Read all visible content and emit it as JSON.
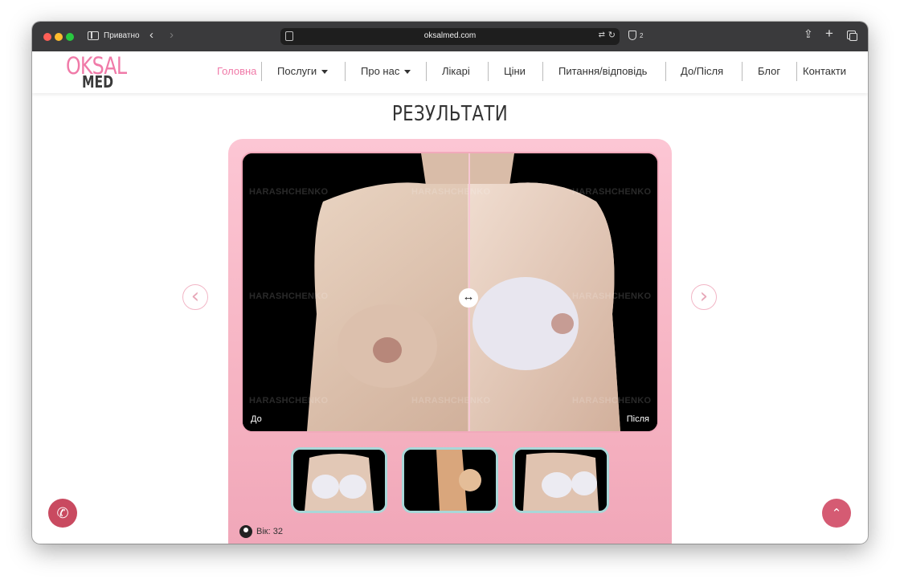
{
  "browser": {
    "private_label": "Приватно",
    "url": "oksalmed.com",
    "back_glyph": "‹",
    "forward_glyph": "›",
    "blocked_count": "2",
    "icons": [
      "sidebar-toggle-icon",
      "back-icon",
      "forward-icon",
      "page-icon",
      "translate-icon",
      "reload-icon",
      "shield-icon",
      "share-icon",
      "new-tab-icon",
      "tabs-overview-icon"
    ]
  },
  "site": {
    "logo": {
      "top": "OKSAL",
      "bottom": "MED"
    },
    "nav": [
      {
        "label": "Головна",
        "active": true
      },
      {
        "label": "Послуги",
        "dropdown": true
      },
      {
        "label": "Про нас",
        "dropdown": true
      },
      {
        "label": "Лікарі"
      },
      {
        "label": "Ціни"
      },
      {
        "label": "Питання/відповідь"
      },
      {
        "label": "До/Після"
      },
      {
        "label": "Блог"
      },
      {
        "label": "Контакти"
      }
    ]
  },
  "section": {
    "title": "РЕЗУЛЬТАТИ",
    "compare": {
      "before_label": "До",
      "after_label": "Після",
      "handle_glyph": "↔",
      "watermark": "HARASHCHENKO"
    },
    "prev_glyph": "‹",
    "next_glyph": "›",
    "thumbnails": [
      "front-view",
      "side-view",
      "three-quarter-view"
    ],
    "age_label": "Вік: 32"
  },
  "floating": {
    "phone_glyph": "✆",
    "scroll_top_glyph": "⌃"
  },
  "colors": {
    "brand_pink": "#f07aa8",
    "card_pink": "#f6b3c2",
    "button_red": "#c94a60",
    "titlebar": "#3a3a3c"
  }
}
